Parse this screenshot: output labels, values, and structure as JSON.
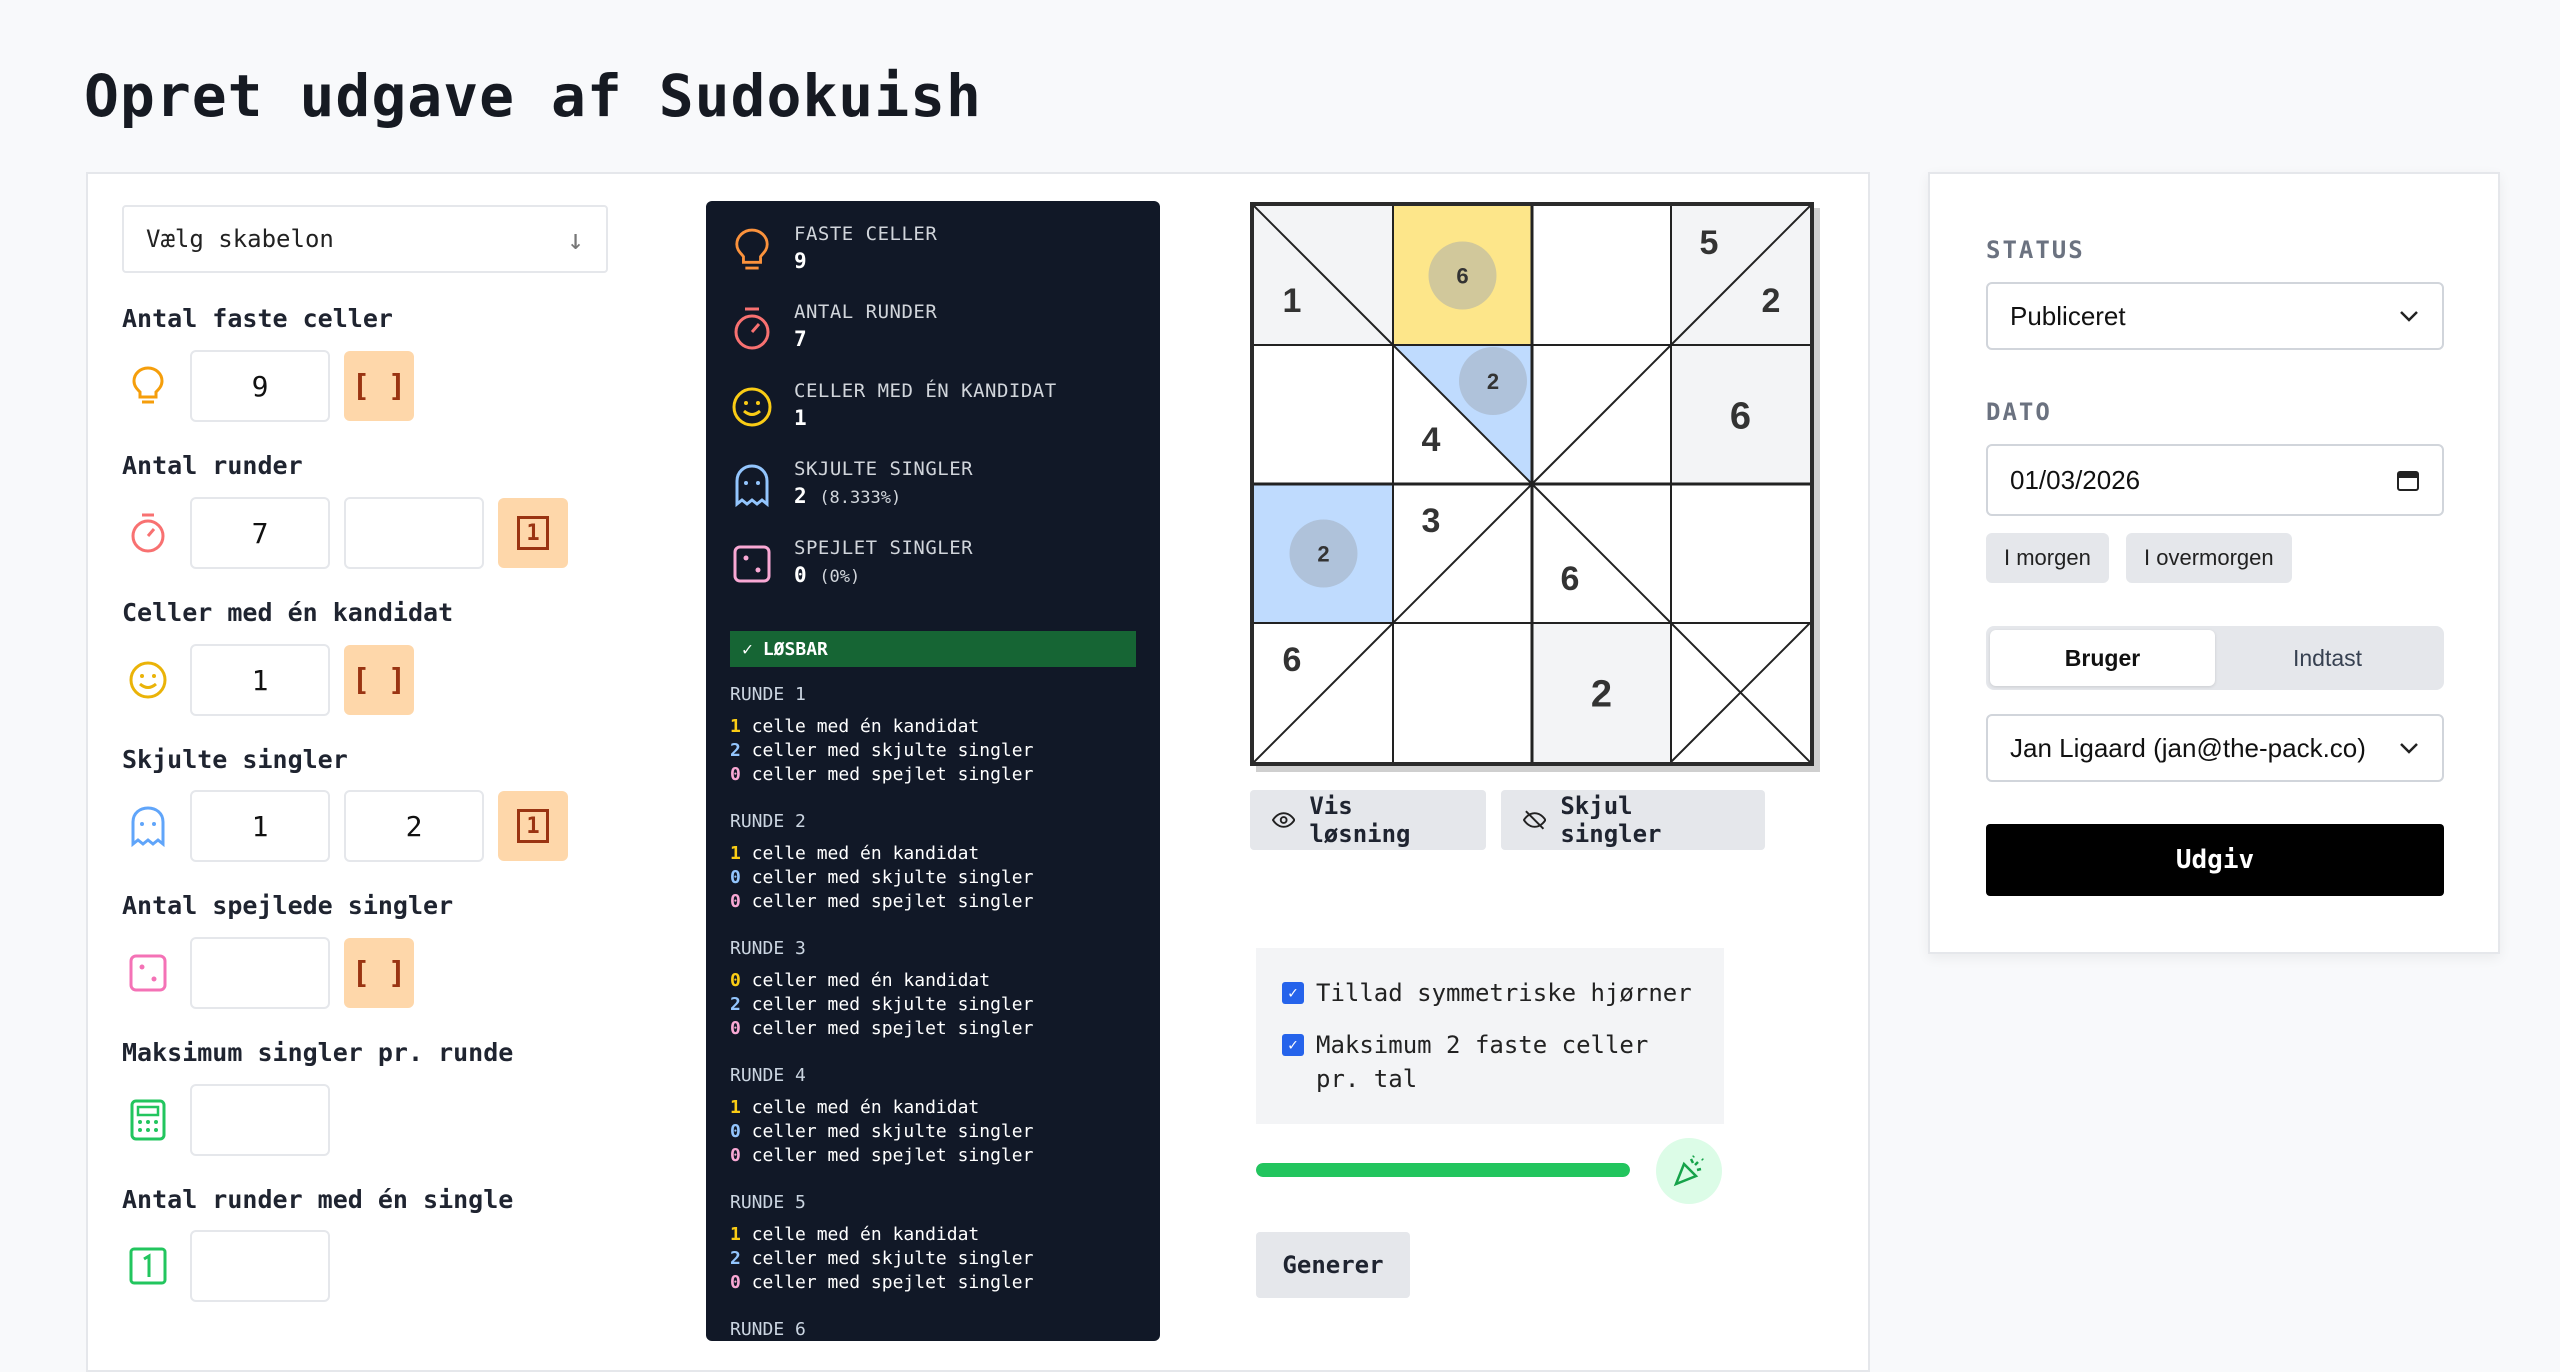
{
  "page_title": "Opret udgave af Sudokuish",
  "template_select": {
    "label": "Vælg skabelon"
  },
  "fields": [
    {
      "label": "Antal faste celler",
      "icon": "lightbulb-icon",
      "values": [
        "9"
      ],
      "toggle": "[ ]"
    },
    {
      "label": "Antal runder",
      "icon": "timer-icon",
      "values": [
        "7",
        ""
      ],
      "toggle": "1"
    },
    {
      "label": "Celler med én kandidat",
      "icon": "smiley-icon",
      "values": [
        "1"
      ],
      "toggle": "[ ]"
    },
    {
      "label": "Skjulte singler",
      "icon": "ghost-icon",
      "values": [
        "1",
        "2"
      ],
      "toggle": "1"
    },
    {
      "label": "Antal spejlede singler",
      "icon": "dice-icon",
      "values": [
        ""
      ],
      "toggle": "[ ]"
    },
    {
      "label": "Maksimum singler pr. runde",
      "icon": "calculator-icon",
      "values": [
        ""
      ]
    },
    {
      "label": "Antal runder med én single",
      "icon": "one-square-icon",
      "values": [
        ""
      ]
    }
  ],
  "stats": [
    {
      "label": "FASTE CELLER",
      "value": "9",
      "pct": ""
    },
    {
      "label": "ANTAL RUNDER",
      "value": "7",
      "pct": ""
    },
    {
      "label": "CELLER MED ÉN KANDIDAT",
      "value": "1",
      "pct": ""
    },
    {
      "label": "SKJULTE SINGLER",
      "value": "2",
      "pct": "(8.333%)"
    },
    {
      "label": "SPEJLET SINGLER",
      "value": "0",
      "pct": "(0%)"
    }
  ],
  "solvable_label": "LØSBAR",
  "rounds": [
    {
      "title": "RUNDE 1",
      "lines": [
        [
          "1",
          "celle med én kandidat"
        ],
        [
          "2",
          "celler med skjulte singler"
        ],
        [
          "0",
          "celler med spejlet singler"
        ]
      ]
    },
    {
      "title": "RUNDE 2",
      "lines": [
        [
          "1",
          "celle med én kandidat"
        ],
        [
          "0",
          "celler med skjulte singler"
        ],
        [
          "0",
          "celler med spejlet singler"
        ]
      ]
    },
    {
      "title": "RUNDE 3",
      "lines": [
        [
          "0",
          "celler med én kandidat"
        ],
        [
          "2",
          "celler med skjulte singler"
        ],
        [
          "0",
          "celler med spejlet singler"
        ]
      ]
    },
    {
      "title": "RUNDE 4",
      "lines": [
        [
          "1",
          "celle med én kandidat"
        ],
        [
          "0",
          "celler med skjulte singler"
        ],
        [
          "0",
          "celler med spejlet singler"
        ]
      ]
    },
    {
      "title": "RUNDE 5",
      "lines": [
        [
          "1",
          "celle med én kandidat"
        ],
        [
          "2",
          "celler med skjulte singler"
        ],
        [
          "0",
          "celler med spejlet singler"
        ]
      ]
    },
    {
      "title": "RUNDE 6",
      "lines": []
    }
  ],
  "grid": {
    "cells": [
      {
        "r": 0,
        "c": 0,
        "diag": "tl-br",
        "tri": "bl",
        "num": "1",
        "fill": "#f3f4f6"
      },
      {
        "r": 0,
        "c": 1,
        "fill": "#fde68a",
        "circle": "6"
      },
      {
        "r": 0,
        "c": 3,
        "diag": "tr-bl",
        "tri": "tl-num",
        "num": "5",
        "num2": "2",
        "fill": "#f3f4f6"
      },
      {
        "r": 1,
        "c": 1,
        "diag": "tl-br",
        "blue_tri": true,
        "circle": "2",
        "num": "4"
      },
      {
        "r": 1,
        "c": 2,
        "diag": "tr-bl"
      },
      {
        "r": 1,
        "c": 3,
        "num": "6",
        "big": true,
        "fill": "#f3f4f6"
      },
      {
        "r": 2,
        "c": 0,
        "fill": "#bfdbfe",
        "circle": "2"
      },
      {
        "r": 2,
        "c": 1,
        "diag": "tr-bl",
        "num": "3"
      },
      {
        "r": 2,
        "c": 2,
        "diag": "tl-br",
        "num": "6"
      },
      {
        "r": 3,
        "c": 0,
        "diag": "tr-bl",
        "num": "6"
      },
      {
        "r": 3,
        "c": 2,
        "num": "2",
        "big": true,
        "fill": "#f3f4f6"
      },
      {
        "r": 3,
        "c": 3,
        "diag": "both"
      }
    ]
  },
  "buttons": {
    "show_solution": "Vis løsning",
    "hide_singles": "Skjul singler",
    "generate": "Generer"
  },
  "checks": [
    {
      "label": "Tillad symmetriske hjørner",
      "checked": true
    },
    {
      "label": "Maksimum 2 faste celler pr. tal",
      "checked": true
    }
  ],
  "progress": 1.0,
  "right": {
    "status_label": "STATUS",
    "status_value": "Publiceret",
    "date_label": "DATO",
    "date_value": "01/03/2026",
    "chip_tomorrow": "I morgen",
    "chip_day_after": "I overmorgen",
    "seg_user": "Bruger",
    "seg_input": "Indtast",
    "user_value": "Jan Ligaard (jan@the-pack.co)",
    "publish": "Udgiv"
  }
}
